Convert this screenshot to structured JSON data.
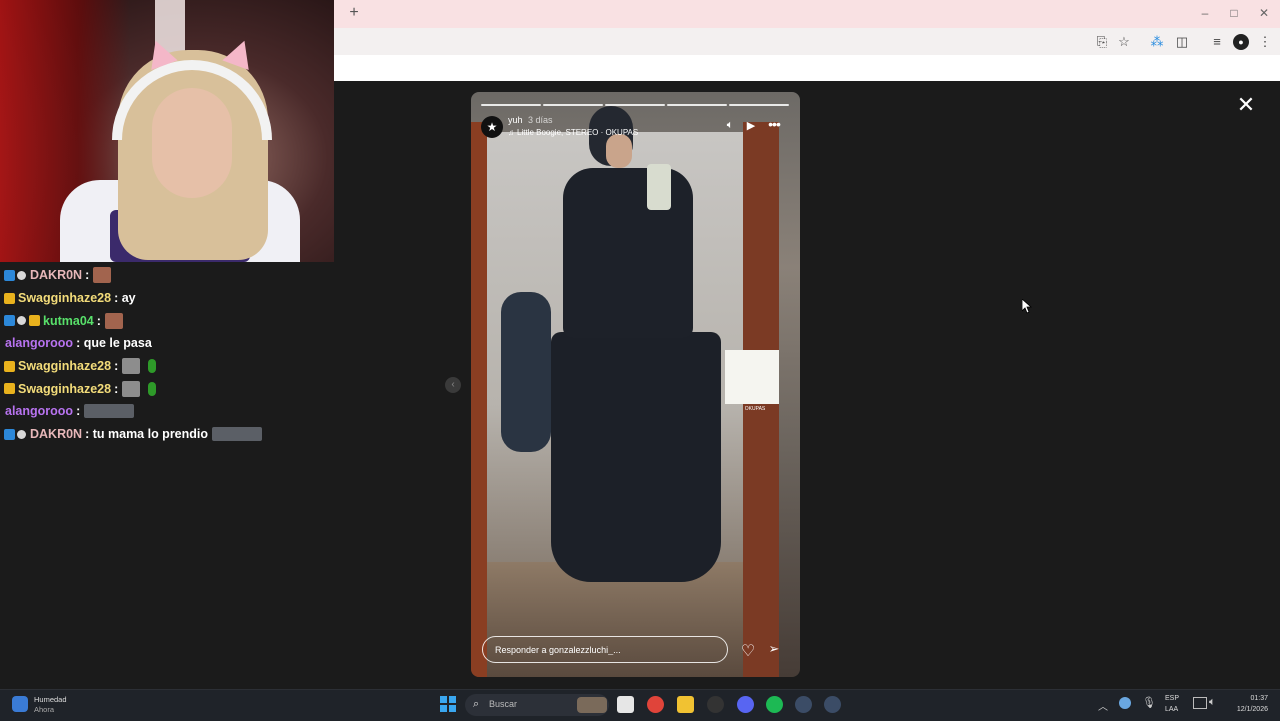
{
  "browser": {
    "new_tab": "+",
    "window_controls": {
      "minimize": "–",
      "restore": "□",
      "close": "✕"
    }
  },
  "chat": {
    "messages": [
      {
        "badges": [
          "blue",
          "white"
        ],
        "user": "DAKR0N",
        "user_color": "#e7b7b9",
        "text": ":",
        "emotes": [
          "brown"
        ]
      },
      {
        "badges": [
          "gold"
        ],
        "user": "Swagginhaze28",
        "user_color": "#f3dc7a",
        "text": ": ay",
        "emotes": []
      },
      {
        "badges": [
          "blue",
          "white",
          "gold"
        ],
        "user": "kutma04",
        "user_color": "#58e06a",
        "text": ":",
        "emotes": [
          "brown"
        ]
      },
      {
        "badges": [],
        "user": "alangorooo",
        "user_color": "#b873f0",
        "text": ": que le pasa",
        "emotes": []
      },
      {
        "badges": [
          "gold"
        ],
        "user": "Swagginhaze28",
        "user_color": "#f3dc7a",
        "text": ":",
        "emotes": [
          "bw",
          "green"
        ]
      },
      {
        "badges": [
          "gold"
        ],
        "user": "Swagginhaze28",
        "user_color": "#f3dc7a",
        "text": ":",
        "emotes": [
          "bw",
          "green"
        ]
      },
      {
        "badges": [],
        "user": "alangorooo",
        "user_color": "#b873f0",
        "text": ":",
        "emotes": [
          "wide"
        ]
      },
      {
        "badges": [
          "blue",
          "white"
        ],
        "user": "DAKR0N",
        "user_color": "#e7b7b9",
        "text": ": tu mama lo prendio",
        "emotes": [
          "wide"
        ]
      }
    ]
  },
  "story": {
    "user": "yuh",
    "time": "3 días",
    "music_icon": "♫",
    "music": "Little Boogie, STEREO · OKUPAS",
    "reply_placeholder": "Responder a gonzalezzluchi_...",
    "poster_caption": "OKUPAS",
    "progress": {
      "segments": 5,
      "current": 5
    },
    "avatar_icon": "star-icon"
  },
  "viewer": {
    "close_icon": "close-icon",
    "prev_icon": "chevron-left-icon"
  },
  "taskbar": {
    "weather_title": "Humedad",
    "weather_sub": "Ahora",
    "search_placeholder": "Buscar",
    "lang_top": "ESP",
    "lang_bottom": "LAA",
    "time": "01:37",
    "date": "12/1/2026",
    "apps": [
      {
        "name": "windows-start",
        "color": "#3aa7f0"
      },
      {
        "name": "task-view",
        "color": "#e6e6e6"
      },
      {
        "name": "chrome",
        "color": "#e0443a"
      },
      {
        "name": "file-explorer",
        "color": "#f1c232"
      },
      {
        "name": "app-dark",
        "color": "#333333"
      },
      {
        "name": "discord",
        "color": "#5865f2"
      },
      {
        "name": "spotify",
        "color": "#1db954"
      },
      {
        "name": "steam",
        "color": "#3b4c66"
      },
      {
        "name": "steam-2",
        "color": "#3b4c66"
      }
    ]
  },
  "colors": {
    "tabbar": "#f9e1e3",
    "toolbar": "#f3f0f0",
    "viewer_bg": "#1b1b1b"
  }
}
